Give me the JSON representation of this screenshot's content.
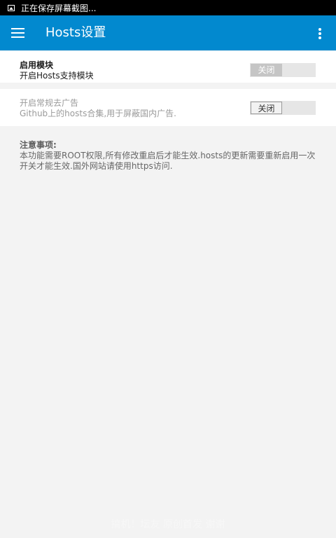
{
  "status_bar": {
    "notification_text": "正在保存屏幕截图...",
    "icon": "image-icon"
  },
  "app_bar": {
    "title": "Hosts设置",
    "menu_icon": "hamburger-menu-icon",
    "overflow_icon": "more-vert-icon"
  },
  "settings": [
    {
      "title": "启用模块",
      "summary": "开启Hosts支持模块",
      "toggle_label": "关闭",
      "enabled": true
    },
    {
      "title": "开启常规去广告",
      "summary": "Github上的hosts合集,用于屏蔽国内广告.",
      "toggle_label": "关闭",
      "enabled": false
    }
  ],
  "notes": {
    "title": "注意事项:",
    "body": "本功能需要ROOT权限,所有修改重启后才能生效.hosts的更新需要重新启用一次开关才能生效.国外网站请使用https访问."
  },
  "watermark": "搞机！坛友 原创首发 谢谢",
  "colors": {
    "app_bar": "#0289cf",
    "status_bar": "#000000",
    "background": "#f3f3f3",
    "row_background": "#ffffff"
  }
}
